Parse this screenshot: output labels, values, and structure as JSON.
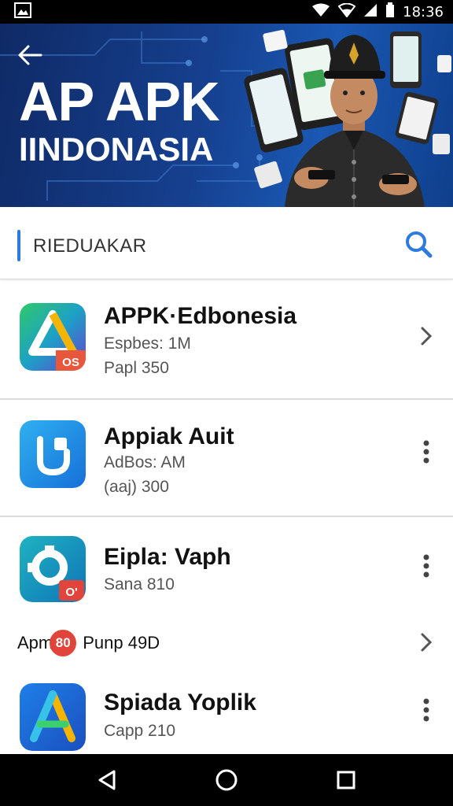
{
  "status_bar": {
    "time": "18:36",
    "icons": [
      "notification-image-icon",
      "wifi-icon",
      "signal-icon",
      "battery-icon"
    ]
  },
  "header": {
    "title": "AP APK",
    "subtitle": "IINDONASIA",
    "back_icon": "back-arrow-icon"
  },
  "search": {
    "value": "RIEDUAKAR",
    "placeholder": "",
    "icon": "search-icon",
    "accent": "#2d7be0"
  },
  "apps": [
    {
      "title": "APPK·Edbonesia",
      "meta1": "Espbes: 1M",
      "meta2": "Papl 350",
      "badge": "OS",
      "action": "chevron-right-icon"
    },
    {
      "title": "Appiak Auit",
      "meta1": "AdBos: AM",
      "meta2": "(aaj) 300",
      "action": "more-vert-icon"
    },
    {
      "title": "Eipla: Vaph",
      "meta1": "Sana 810",
      "badge": "O'",
      "action": "more-vert-icon"
    },
    {
      "title": "Spiada Yoplik",
      "meta1": "Capp 210",
      "action": "more-vert-icon"
    }
  ],
  "inline_row": {
    "prefix": "Apm",
    "badge": "80",
    "label": "Punp 49D",
    "action": "chevron-right-icon"
  },
  "nav": {
    "buttons": [
      "back-triangle-icon",
      "home-circle-icon",
      "recents-square-icon"
    ]
  },
  "colors": {
    "banner_dark": "#0f2a66",
    "banner_light": "#1a58b3",
    "badge_red": "#e0443a"
  }
}
